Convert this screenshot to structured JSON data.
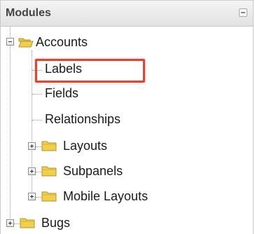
{
  "panel": {
    "title": "Modules"
  },
  "tree": {
    "accounts": {
      "label": "Accounts",
      "children": {
        "labels": "Labels",
        "fields": "Fields",
        "relationships": "Relationships",
        "layouts": "Layouts",
        "subpanels": "Subpanels",
        "mobile_layouts": "Mobile Layouts"
      }
    },
    "bugs": {
      "label": "Bugs"
    }
  },
  "colors": {
    "highlight": "#e8412c",
    "folder_fill": "#f2cf4a",
    "folder_outline": "#b8902a"
  }
}
